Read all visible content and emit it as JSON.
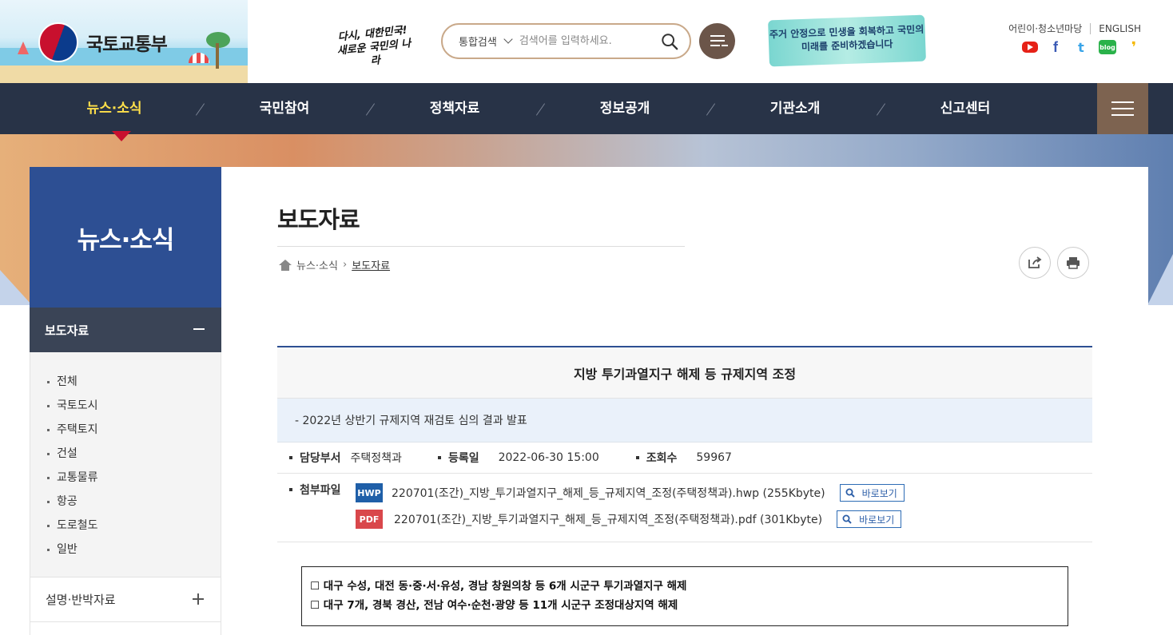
{
  "header": {
    "logo_text": "국토교통부",
    "slogan_left": "다시, 대한민국! 새로운 국민의 나라",
    "search": {
      "type_label": "통합검색",
      "placeholder": "검색어를 입력하세요."
    },
    "slogan_right": "주거 안정으로 민생을 회복하고 국민의 미래를 준비하겠습니다",
    "links": [
      "어린이·청소년마당",
      "ENGLISH"
    ],
    "sns": [
      "youtube",
      "facebook",
      "twitter",
      "blog",
      "kakao"
    ]
  },
  "nav": {
    "items": [
      "뉴스·소식",
      "국민참여",
      "정책자료",
      "정보공개",
      "기관소개",
      "신고센터"
    ],
    "active_index": 0,
    "active_color": "#ffe04a",
    "bg_color": "#283347"
  },
  "sidebar": {
    "heading": "뉴스·소식",
    "section": "보도자료",
    "items": [
      "전체",
      "국토도시",
      "주택토지",
      "건설",
      "교통물류",
      "항공",
      "도로철도",
      "일반"
    ],
    "next_section": "설명·반박자료",
    "accent_color": "#2d4f93"
  },
  "page": {
    "title": "보도자료",
    "breadcrumb": [
      "뉴스·소식",
      "보도자료"
    ]
  },
  "article": {
    "title": "지방 투기과열지구 해제 등 규제지역 조정",
    "subtitle": "-  2022년 상반기 규제지역 재검토 심의 결과 발표",
    "meta": {
      "dept_label": "담당부서",
      "dept": "주택정책과",
      "date_label": "등록일",
      "date": "2022-06-30 15:00",
      "views_label": "조회수",
      "views": "59967"
    },
    "attach_label": "첨부파일",
    "files": [
      {
        "type": "HWP",
        "name": "220701(조간)_지방_투기과열지구_해제_등_규제지역_조정(주택정책과).hwp (255Kbyte)",
        "view": "바로보기"
      },
      {
        "type": "PDF",
        "name": "220701(조간)_지방_투기과열지구_해제_등_규제지역_조정(주택정책과).pdf (301Kbyte)",
        "view": "바로보기"
      }
    ],
    "summary": [
      "☐ 대구 수성, 대전 동·중·서·유성, 경남 창원의창 등 6개 시군구 투기과열지구 해제",
      "☐ 대구 7개, 경북 경산, 전남 여수·순천·광양 등 11개 시군구 조정대상지역 해제"
    ]
  }
}
